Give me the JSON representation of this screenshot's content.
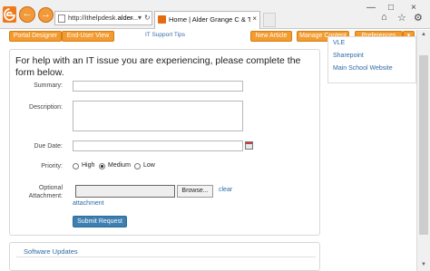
{
  "browser": {
    "url_prefix": "http://ithelpdesk.",
    "url_host": "alder...",
    "tab_title": "Home | Alder Grange C & T...",
    "tab_close": "×",
    "window_controls": [
      "—",
      "□",
      "×"
    ],
    "tool_icons": [
      "home-icon",
      "star-icon",
      "gear-icon"
    ]
  },
  "toolbar": {
    "portal_designer": "Portal Designer",
    "end_user_view": "End-User View",
    "it_support_tips": "IT Support Tips",
    "new_article": "New Article",
    "manage_content": "Manage Content",
    "preferences": "Preferences",
    "dropdown_arrow": "▾"
  },
  "form": {
    "intro": "For help with an IT issue you are experiencing, please complete the form below.",
    "summary_label": "Summary:",
    "summary_value": "",
    "description_label": "Description:",
    "description_value": "",
    "due_date_label": "Due Date:",
    "due_date_value": "",
    "priority_label": "Priority:",
    "priority_options": [
      "High",
      "Medium",
      "Low"
    ],
    "priority_selected": "Medium",
    "attachment_label_1": "Optional",
    "attachment_label_2": "Attachment:",
    "browse": "Browse...",
    "clear_1": "clear",
    "clear_2": "attachment",
    "submit": "Submit Request"
  },
  "software_updates": {
    "title": "Software Updates"
  },
  "sidebar": {
    "links": [
      "VLE",
      "Sharepoint",
      "Main School Website"
    ]
  },
  "colors": {
    "accent_orange": "#f39b2f",
    "link_blue": "#2e6aa6",
    "submit_blue": "#3d7fb0"
  }
}
